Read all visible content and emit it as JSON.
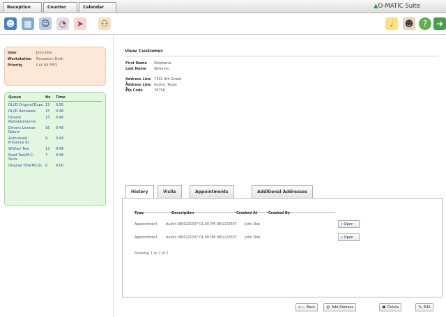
{
  "tabs": [
    {
      "label": "Reception"
    },
    {
      "label": "Counter"
    },
    {
      "label": "Calendar"
    }
  ],
  "brand": "O-MATIC Suite",
  "toolbar_left": [
    "customer-icon",
    "calculator-icon",
    "users-icon",
    "pie-chart-icon",
    "pushpin-icon",
    "people-icon"
  ],
  "toolbar_right": [
    "bell-icon",
    "user-status-icon",
    "help-icon",
    "logout-icon"
  ],
  "user": {
    "user_label": "User",
    "user_value": "John Doe",
    "workstation_label": "Workstation",
    "workstation_value": "Reception Desk",
    "priority_label": "Priority",
    "priority_value": "Call All FIFO"
  },
  "queue": {
    "headers": {
      "queue": "Queue",
      "no": "No",
      "time": "Time"
    },
    "rows": [
      {
        "name": "DL/ID Original/Dupe",
        "no": "13",
        "time": "0:50"
      },
      {
        "name": "DL/ID Renewals",
        "no": "15",
        "time": "0:48"
      },
      {
        "name": "Drivers Reinstatements",
        "no": "13",
        "time": "0:48"
      },
      {
        "name": "Drivers License Return",
        "no": "16",
        "time": "0:48"
      },
      {
        "name": "Authorized Presence ID",
        "no": "9",
        "time": "0:48"
      },
      {
        "name": "Written Test",
        "no": "13",
        "time": "0:48"
      },
      {
        "name": "Road Test/M.C. Skills",
        "no": "7",
        "time": "0:48"
      },
      {
        "name": "Original Title/MCOs",
        "no": "0",
        "time": "0:00"
      }
    ]
  },
  "customer": {
    "title": "View Customer",
    "first_name_label": "First Name",
    "first_name": "Stephanie",
    "last_name_label": "Last Name",
    "last_name": "Williams",
    "addr1_label": "Address Line 1",
    "addr1": "7392 4th Street",
    "addr2_label": "Address Line 2",
    "addr2": "Austin, Texas",
    "zip_label": "Zip Code",
    "zip": "78756"
  },
  "panel_tabs": [
    {
      "label": "History"
    },
    {
      "label": "Visits"
    },
    {
      "label": "Appointments"
    },
    {
      "label": "Additional Addresses"
    }
  ],
  "history": {
    "headers": {
      "type": "Type",
      "description": "Description",
      "created_at": "Created At",
      "created_by": "Created By"
    },
    "rows": [
      {
        "type": "Appointment",
        "description": "Austin 08/02/2007 01:00 PM",
        "created_at": "08/22/2007",
        "created_by": "John Doe",
        "action": "Open"
      },
      {
        "type": "Appointment",
        "description": "Austin 08/02/2007 01:00 PM",
        "created_at": "08/22/2007",
        "created_by": "John Doe",
        "action": "Open"
      }
    ],
    "showing": "Showing 1 to 2 of 2"
  },
  "actions": {
    "back": "Back",
    "add_address": "Add Address",
    "delete": "Delete",
    "edit": "Edit"
  }
}
